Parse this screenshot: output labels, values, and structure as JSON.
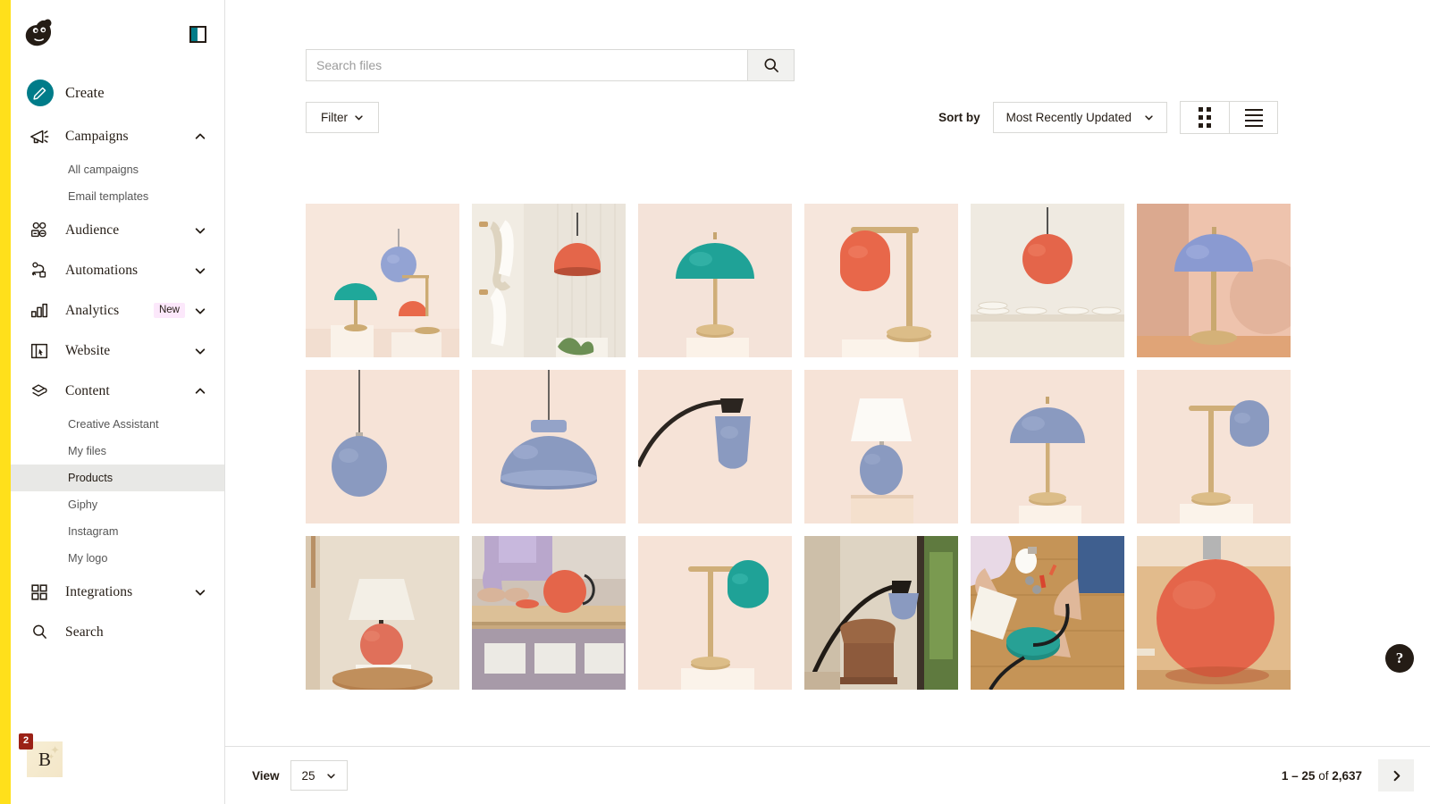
{
  "brand": {
    "logo_icon": "mailchimp-freddie-logo",
    "accent_color": "#ffe01b",
    "teal_color": "#007c89"
  },
  "sidebar": {
    "panel_toggle_icon": "panel-collapse-icon",
    "create": {
      "label": "Create",
      "icon": "pencil-icon"
    },
    "items": [
      {
        "label": "Campaigns",
        "icon": "megaphone-icon",
        "expanded": true,
        "chevron": "chevron-up-icon",
        "children": [
          {
            "label": "All campaigns",
            "active": false
          },
          {
            "label": "Email templates",
            "active": false
          }
        ]
      },
      {
        "label": "Audience",
        "icon": "people-icon",
        "expanded": false,
        "chevron": "chevron-down-icon",
        "children": []
      },
      {
        "label": "Automations",
        "icon": "automation-path-icon",
        "expanded": false,
        "chevron": "chevron-down-icon",
        "children": []
      },
      {
        "label": "Analytics",
        "icon": "bar-chart-icon",
        "expanded": false,
        "chevron": "chevron-down-icon",
        "badge": "New",
        "children": []
      },
      {
        "label": "Website",
        "icon": "website-window-icon",
        "expanded": false,
        "chevron": "chevron-down-icon",
        "children": []
      },
      {
        "label": "Content",
        "icon": "content-stack-icon",
        "expanded": true,
        "chevron": "chevron-up-icon",
        "children": [
          {
            "label": "Creative Assistant",
            "active": false
          },
          {
            "label": "My files",
            "active": false
          },
          {
            "label": "Products",
            "active": true
          },
          {
            "label": "Giphy",
            "active": false
          },
          {
            "label": "Instagram",
            "active": false
          },
          {
            "label": "My logo",
            "active": false
          }
        ]
      },
      {
        "label": "Integrations",
        "icon": "grid-squares-icon",
        "expanded": false,
        "chevron": "chevron-down-icon",
        "children": []
      },
      {
        "label": "Search",
        "icon": "search-icon",
        "expanded": false,
        "chevron": "",
        "children": []
      }
    ],
    "account": {
      "avatar_initial": "B",
      "notification_count": "2"
    }
  },
  "toolbar": {
    "search_placeholder": "Search files",
    "search_value": "",
    "search_button_icon": "search-icon",
    "filter_label": "Filter",
    "filter_chevron": "chevron-down-icon",
    "sort_by_label": "Sort by",
    "sort_value": "Most Recently Updated",
    "sort_chevron": "chevron-down-icon",
    "grid_view_icon": "grid-view-icon",
    "list_view_icon": "list-view-icon",
    "grid_view_active": true
  },
  "gallery": {
    "tiles": [
      {
        "name": "three-lamps-teal-blue-coral-on-pedestals",
        "bg": "#f6e4da",
        "scene": "trio"
      },
      {
        "name": "coral-pendant-lamp-in-bathroom-with-towels",
        "bg": "#e8e2d8",
        "scene": "bathroom"
      },
      {
        "name": "teal-dome-table-lamp-on-pedestal",
        "bg": "#f4e3d9",
        "scene": "dome-teal"
      },
      {
        "name": "coral-globe-desk-lamp-brass-arm",
        "bg": "#f6e6dc",
        "scene": "arm-coral"
      },
      {
        "name": "coral-pendant-lamp-over-kitchen-shelf",
        "bg": "#efe9e0",
        "scene": "kitchen"
      },
      {
        "name": "blue-dome-table-lamp-pink-wall",
        "bg": "#f0cdbc",
        "scene": "dome-blue-pink"
      },
      {
        "name": "blue-globe-pendant-lamp",
        "bg": "#f6e3d7",
        "scene": "pendant-globe"
      },
      {
        "name": "blue-wide-dome-pendant-lamp",
        "bg": "#f6e3d7",
        "scene": "pendant-wide"
      },
      {
        "name": "blue-arc-floor-lamp-shade-closeup",
        "bg": "#f6e3d7",
        "scene": "arc-closeup"
      },
      {
        "name": "blue-ceramic-lamp-white-shade",
        "bg": "#f6e3d7",
        "scene": "white-shade-blue"
      },
      {
        "name": "blue-dome-table-lamp-pedestal",
        "bg": "#f6e3d7",
        "scene": "dome-blue"
      },
      {
        "name": "blue-globe-desk-lamp-brass-arm",
        "bg": "#f6e3d7",
        "scene": "arm-blue"
      },
      {
        "name": "coral-ceramic-lamp-on-books-side-table",
        "bg": "#e6dbcb",
        "scene": "bedside"
      },
      {
        "name": "worker-assembling-coral-lamp-in-warehouse",
        "bg": "#c9b9ad",
        "scene": "warehouse"
      },
      {
        "name": "teal-globe-desk-lamp-brass-arm",
        "bg": "#f6e3d7",
        "scene": "arm-teal"
      },
      {
        "name": "blue-arc-floor-lamp-over-leather-chair",
        "bg": "#ded5c6",
        "scene": "livingroom"
      },
      {
        "name": "hands-assembling-teal-lamp-base-on-table",
        "bg": "#c89b62",
        "scene": "assembly"
      },
      {
        "name": "coral-globe-lamp-base-closeup-on-floor",
        "bg": "#e0b887",
        "scene": "base-closeup"
      }
    ]
  },
  "footer": {
    "view_label": "View",
    "view_value": "25",
    "view_chevron": "chevron-down-icon",
    "page_range_prefix": "1 – 25",
    "page_range_middle": " of ",
    "page_total": "2,637",
    "next_icon": "chevron-right-icon"
  },
  "help": {
    "label": "?",
    "icon": "help-question-icon"
  }
}
